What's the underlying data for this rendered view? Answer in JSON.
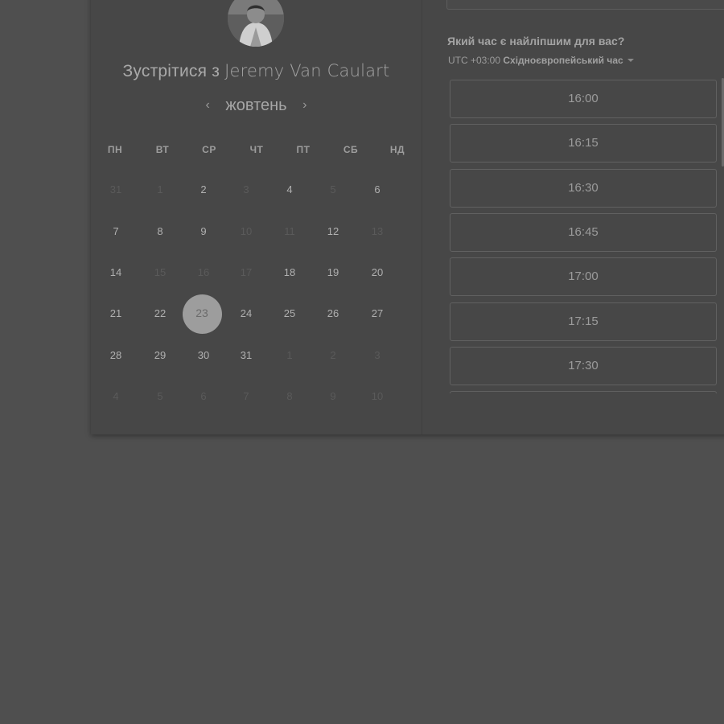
{
  "booking": {
    "title_prefix": "Зустрітися з ",
    "host_name": "Jeremy Van Caulart"
  },
  "calendar": {
    "month": "жовтень",
    "prev_icon": "chevron-left-icon",
    "next_icon": "chevron-right-icon",
    "weekdays": [
      "ПН",
      "ВТ",
      "СР",
      "ЧТ",
      "ПТ",
      "СБ",
      "НД"
    ],
    "weeks": [
      [
        {
          "d": "31",
          "m": true
        },
        {
          "d": "1",
          "m": true
        },
        {
          "d": "2",
          "m": false
        },
        {
          "d": "3",
          "m": true
        },
        {
          "d": "4",
          "m": false
        },
        {
          "d": "5",
          "m": true
        },
        {
          "d": "6",
          "m": false
        }
      ],
      [
        {
          "d": "7",
          "m": false
        },
        {
          "d": "8",
          "m": false
        },
        {
          "d": "9",
          "m": false
        },
        {
          "d": "10",
          "m": true
        },
        {
          "d": "11",
          "m": true
        },
        {
          "d": "12",
          "m": false
        },
        {
          "d": "13",
          "m": true
        }
      ],
      [
        {
          "d": "14",
          "m": false
        },
        {
          "d": "15",
          "m": true
        },
        {
          "d": "16",
          "m": true
        },
        {
          "d": "17",
          "m": true
        },
        {
          "d": "18",
          "m": false
        },
        {
          "d": "19",
          "m": false
        },
        {
          "d": "20",
          "m": false
        }
      ],
      [
        {
          "d": "21",
          "m": false
        },
        {
          "d": "22",
          "m": false
        },
        {
          "d": "23",
          "m": false
        },
        {
          "d": "24",
          "m": false
        },
        {
          "d": "25",
          "m": false
        },
        {
          "d": "26",
          "m": false
        },
        {
          "d": "27",
          "m": false
        }
      ],
      [
        {
          "d": "28",
          "m": false
        },
        {
          "d": "29",
          "m": false
        },
        {
          "d": "30",
          "m": false
        },
        {
          "d": "31",
          "m": false
        },
        {
          "d": "1",
          "m": true
        },
        {
          "d": "2",
          "m": true
        },
        {
          "d": "3",
          "m": true
        }
      ],
      [
        {
          "d": "4",
          "m": true
        },
        {
          "d": "5",
          "m": true
        },
        {
          "d": "6",
          "m": true
        },
        {
          "d": "7",
          "m": true
        },
        {
          "d": "8",
          "m": true
        },
        {
          "d": "9",
          "m": true
        },
        {
          "d": "10",
          "m": true
        }
      ]
    ],
    "selected_day": "23"
  },
  "times": {
    "question": "Який час є найліпшим для вас?",
    "timezone_offset": "UTC +03:00 ",
    "timezone_name": "Східноєвропейський час",
    "slots": [
      "16:00",
      "16:15",
      "16:30",
      "16:45",
      "17:00",
      "17:15",
      "17:30",
      ""
    ]
  }
}
